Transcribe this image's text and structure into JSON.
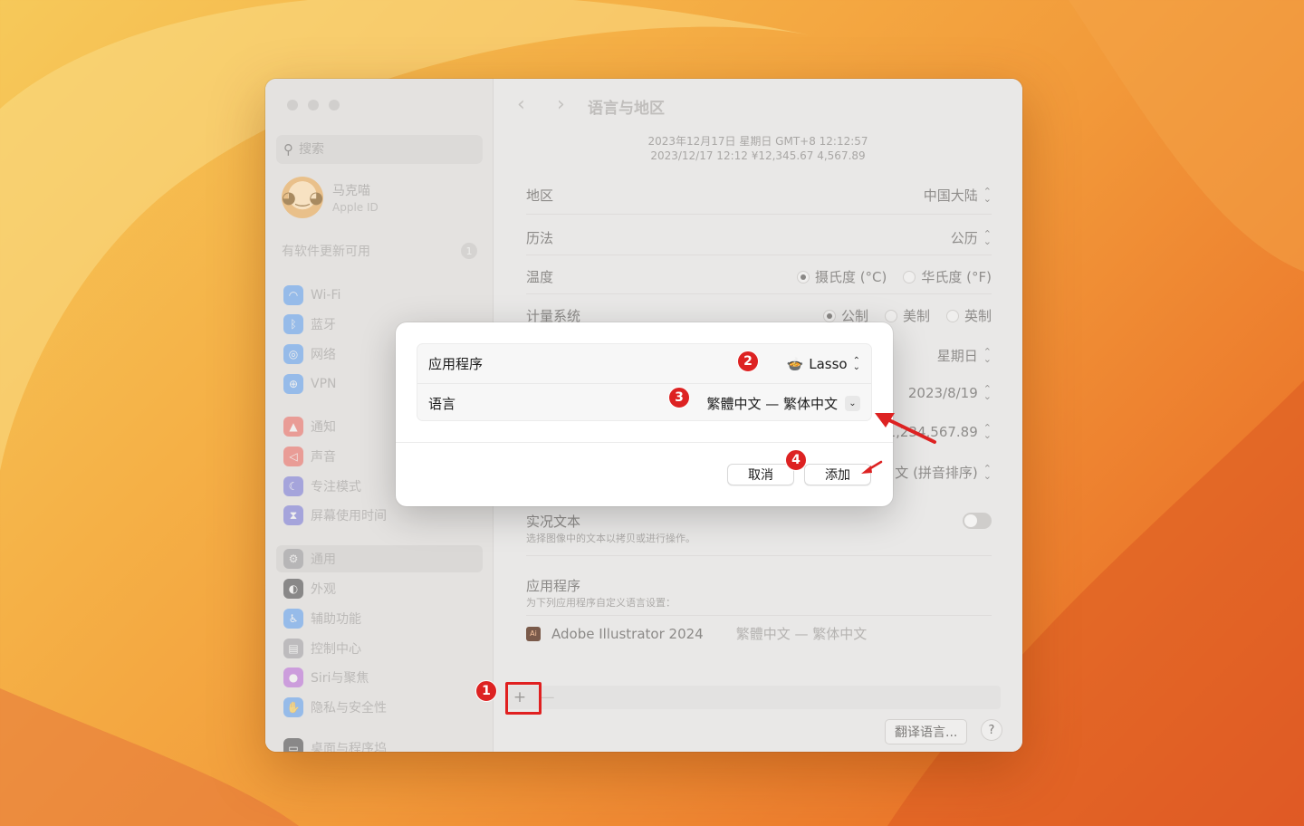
{
  "window": {
    "sidebar": {
      "search_placeholder": "搜索",
      "profile": {
        "name": "马克喵",
        "subtitle": "Apple ID"
      },
      "update": {
        "label": "有软件更新可用",
        "count": "1"
      },
      "items": [
        {
          "label": "Wi-Fi",
          "icon": "wifi-icon",
          "color": "#3a8ef6"
        },
        {
          "label": "蓝牙",
          "icon": "bluetooth-icon",
          "color": "#3a8ef6"
        },
        {
          "label": "网络",
          "icon": "globe-icon",
          "color": "#3a8ef6"
        },
        {
          "label": "VPN",
          "icon": "vpn-icon",
          "color": "#3a8ef6"
        },
        {
          "label": "通知",
          "icon": "bell-icon",
          "color": "#f0483e"
        },
        {
          "label": "声音",
          "icon": "speaker-icon",
          "color": "#f0483e"
        },
        {
          "label": "专注模式",
          "icon": "moon-icon",
          "color": "#5b5bd6"
        },
        {
          "label": "屏幕使用时间",
          "icon": "hourglass-icon",
          "color": "#5b5bd6"
        },
        {
          "label": "通用",
          "icon": "gear-icon",
          "color": "#8e8e93"
        },
        {
          "label": "外观",
          "icon": "appearance-icon",
          "color": "#1c1c1e"
        },
        {
          "label": "辅助功能",
          "icon": "accessibility-icon",
          "color": "#3a8ef6"
        },
        {
          "label": "控制中心",
          "icon": "control-center-icon",
          "color": "#8e8e93"
        },
        {
          "label": "Siri与聚焦",
          "icon": "siri-icon",
          "color": "#b04ad8"
        },
        {
          "label": "隐私与安全性",
          "icon": "hand-icon",
          "color": "#3a8ef6"
        },
        {
          "label": "桌面与程序坞",
          "icon": "dock-icon",
          "color": "#1c1c1e"
        }
      ]
    },
    "main": {
      "title": "语言与地区",
      "date_preview_1": "2023年12月17日 星期日 GMT+8 12:12:57",
      "date_preview_2": "2023/12/17 12:12    ¥12,345.67    4,567.89",
      "rows": {
        "region": {
          "label": "地区",
          "value": "中国大陆"
        },
        "calendar": {
          "label": "历法",
          "value": "公历"
        },
        "temperature": {
          "label": "温度",
          "opt1": "摄氏度 (°C)",
          "opt2": "华氏度 (°F)"
        },
        "measurement": {
          "label": "计量系统",
          "opt1": "公制",
          "opt2": "美制",
          "opt3": "英制"
        },
        "first_day": {
          "value": "星期日"
        },
        "date_format": {
          "value": "2023/8/19"
        },
        "number_format": {
          "value": "1,234,567.89"
        },
        "list_sort": {
          "value": "文 (拼音排序)"
        }
      },
      "live_text": {
        "title": "实况文本",
        "subtitle": "选择图像中的文本以拷贝或进行操作。"
      },
      "apps_section": {
        "title": "应用程序",
        "subtitle": "为下列应用程序自定义语言设置：",
        "items": [
          {
            "icon_text": "Ai",
            "name": "Adobe Illustrator 2024",
            "language": "繁體中文 — 繁体中文"
          }
        ]
      },
      "add_symbol": "+",
      "remove_symbol": "—",
      "translate_button": "翻译语言...",
      "help_button": "?"
    }
  },
  "dialog": {
    "app_label": "应用程序",
    "app_value": "Lasso",
    "language_label": "语言",
    "language_value": "繁體中文 — 繁体中文",
    "cancel": "取消",
    "add": "添加"
  },
  "markers": [
    "1",
    "2",
    "3",
    "4"
  ],
  "colors": {
    "accent_red": "#dd2222"
  }
}
